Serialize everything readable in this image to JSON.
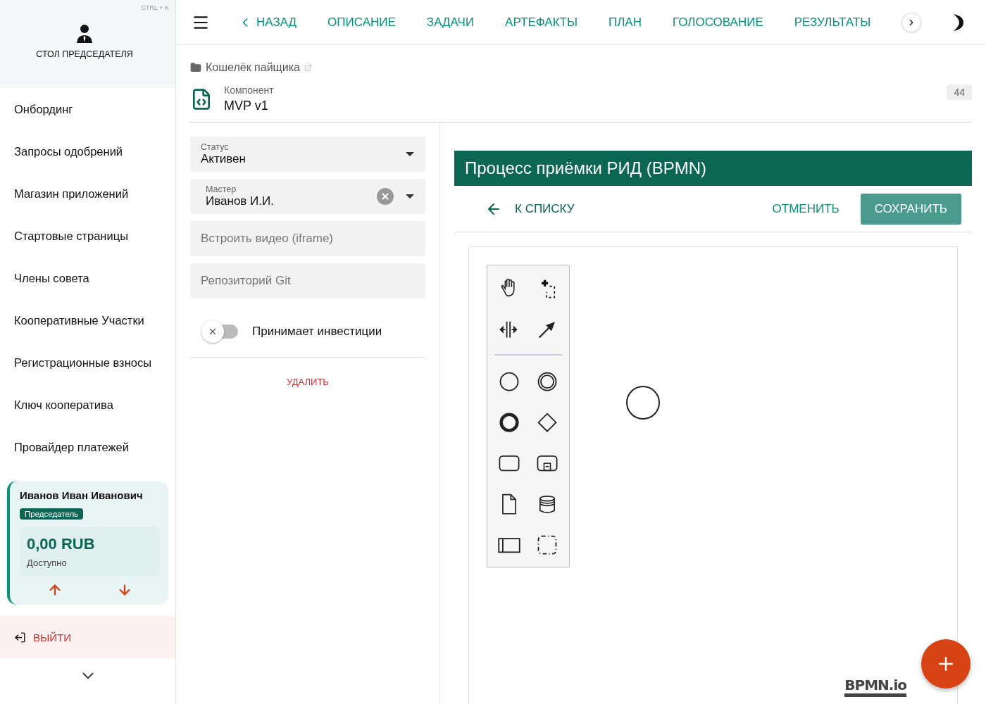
{
  "sidebar": {
    "shortcut": "CTRL + K",
    "title": "СТОЛ ПРЕДСЕДАТЕЛЯ",
    "items": [
      {
        "label": "Онбординг"
      },
      {
        "label": "Запросы одобрений"
      },
      {
        "label": "Магазин приложений"
      },
      {
        "label": "Стартовые страницы"
      },
      {
        "label": "Члены совета"
      },
      {
        "label": "Кооперативные Участки"
      },
      {
        "label": "Регистрационные взносы"
      },
      {
        "label": "Ключ кооператива"
      },
      {
        "label": "Провайдер платежей"
      }
    ],
    "user": {
      "name": "Иванов Иван Иванович",
      "role": "Председатель",
      "balance": "0,00 RUB",
      "balance_label": "Доступно"
    },
    "logout": "ВЫЙТИ"
  },
  "topbar": {
    "tabs": [
      {
        "label": "НАЗАД",
        "kind": "back"
      },
      {
        "label": "ОПИСАНИЕ",
        "kind": "tab"
      },
      {
        "label": "ЗАДАЧИ",
        "kind": "tab"
      },
      {
        "label": "АРТЕФАКТЫ",
        "kind": "tab"
      },
      {
        "label": "ПЛАН",
        "kind": "tab"
      },
      {
        "label": "ГОЛОСОВАНИЕ",
        "kind": "tab"
      },
      {
        "label": "РЕЗУЛЬТАТЫ",
        "kind": "tab"
      }
    ]
  },
  "breadcrumb": "Кошелёк пайщика",
  "header": {
    "caption": "Компонент",
    "title": "MVP v1",
    "count": "44"
  },
  "form": {
    "fields": [
      {
        "kind": "select",
        "label": "Статус",
        "value": "Активен"
      },
      {
        "kind": "select-clear",
        "label": "Мастер",
        "value": "Иванов И.И."
      },
      {
        "kind": "input",
        "placeholder": "Встроить видео (iframe)"
      },
      {
        "kind": "input",
        "placeholder": "Репозиторий Git"
      }
    ],
    "toggle": {
      "label": "Принимает инвестиции",
      "on": false
    },
    "delete": "УДАЛИТЬ"
  },
  "editor": {
    "title": "Процесс приёмки РИД (BPMN)",
    "back": "К СПИСКУ",
    "cancel": "ОТМЕНИТЬ",
    "save": "СОХРАНИТЬ",
    "logo": "BPMN.io"
  }
}
